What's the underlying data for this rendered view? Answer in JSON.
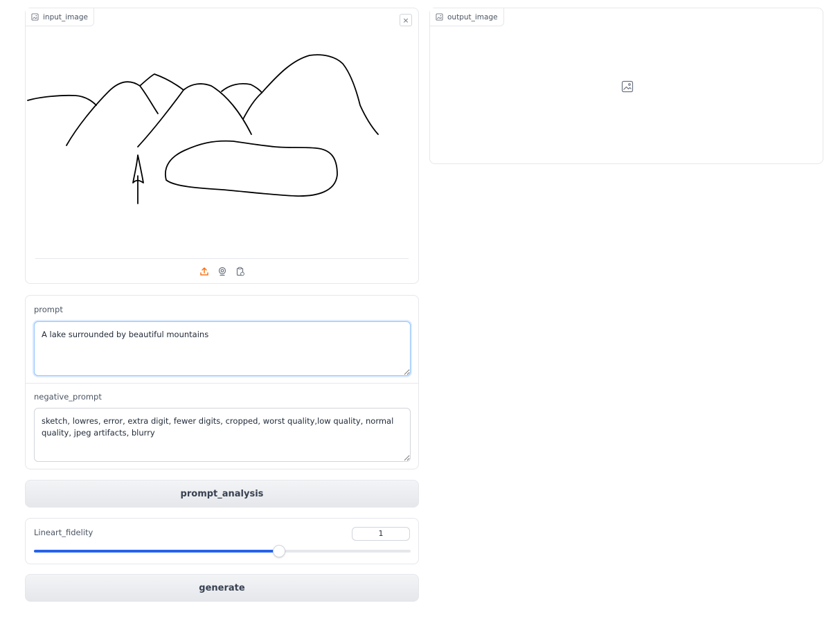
{
  "input_image": {
    "label": "input_image",
    "clear_symbol": "×",
    "source_icons": [
      "upload-icon",
      "webcam-icon",
      "clipboard-icon"
    ]
  },
  "output_image": {
    "label": "output_image",
    "placeholder_icon": "image-icon"
  },
  "prompt": {
    "label": "prompt",
    "value": "A lake surrounded by beautiful mountains"
  },
  "negative_prompt": {
    "label": "negative_prompt",
    "value": "sketch, lowres, error, extra digit, fewer digits, cropped, worst quality,low quality, normal quality, jpeg artifacts, blurry"
  },
  "prompt_analysis_button": {
    "label": "prompt_analysis"
  },
  "lineart_fidelity": {
    "label": "Lineart_fidelity",
    "value": "1",
    "fraction": 0.65
  },
  "generate_button": {
    "label": "generate"
  },
  "colors": {
    "accent": "#2563eb",
    "upload_icon": "#f97316",
    "border": "#e5e7eb"
  }
}
